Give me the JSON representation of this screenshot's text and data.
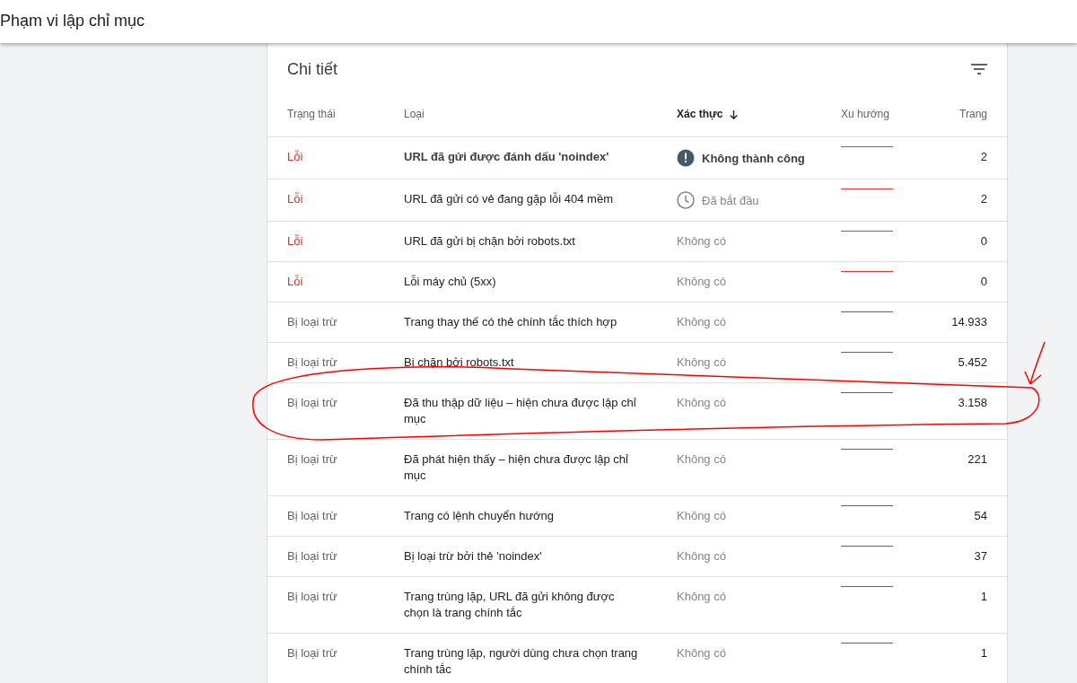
{
  "header": {
    "title": "Phạm vi lập chỉ mục"
  },
  "card": {
    "title": "Chi tiết"
  },
  "table": {
    "columns": [
      {
        "label": "Trạng thái",
        "sorted": false
      },
      {
        "label": "Loại",
        "sorted": false
      },
      {
        "label": "Xác thực",
        "sorted": true
      },
      {
        "label": "Xu hướng",
        "sorted": false
      },
      {
        "label": "Trang",
        "sorted": false
      }
    ],
    "rows": [
      {
        "status": {
          "text": "Lỗi",
          "color": "#d93025"
        },
        "type": "URL đã gửi được đánh dấu 'noindex'",
        "validation": {
          "text": "Không thành công",
          "kind": "failed"
        },
        "trend": {
          "color": "#e53935"
        },
        "pages": "2"
      },
      {
        "status": {
          "text": "Lỗi",
          "color": "#d93025"
        },
        "type": "URL đã gửi có vẻ đang gặp lỗi 404 mềm",
        "validation": {
          "text": "Đã bắt đầu",
          "kind": "started"
        },
        "trend": {
          "color": "#e53935"
        },
        "pages": "2"
      },
      {
        "status": {
          "text": "Lỗi",
          "color": "#d93025"
        },
        "type": "URL đã gửi bị chặn bởi robots.txt",
        "validation": {
          "text": "Không có",
          "kind": "none"
        },
        "trend": {
          "color": "#e53935"
        },
        "pages": "0"
      },
      {
        "status": {
          "text": "Lỗi",
          "color": "#d93025"
        },
        "type": "Lỗi máy chủ (5xx)",
        "validation": {
          "text": "Không có",
          "kind": "none"
        },
        "trend": {
          "color": "#e53935"
        },
        "pages": "0"
      },
      {
        "status": {
          "text": "Bị loại trừ",
          "color": "#5f6368"
        },
        "type": "Trang thay thế có thẻ chính tắc thích hợp",
        "validation": {
          "text": "Không có",
          "kind": "none"
        },
        "trend": {
          "color": "#5f6368"
        },
        "pages": "14.933"
      },
      {
        "status": {
          "text": "Bị loại trừ",
          "color": "#5f6368"
        },
        "type": "Bị chặn bởi robots.txt",
        "validation": {
          "text": "Không có",
          "kind": "none"
        },
        "trend": {
          "color": "#5f6368"
        },
        "pages": "5.452"
      },
      {
        "status": {
          "text": "Bị loại trừ",
          "color": "#5f6368"
        },
        "type": "Đã thu thập dữ liệu – hiện chưa được lập chỉ mục",
        "validation": {
          "text": "Không có",
          "kind": "none"
        },
        "trend": {
          "color": "#5f6368"
        },
        "pages": "3.158"
      },
      {
        "status": {
          "text": "Bị loại trừ",
          "color": "#5f6368"
        },
        "type": "Đã phát hiện thấy – hiện chưa được lập chỉ mục",
        "validation": {
          "text": "Không có",
          "kind": "none"
        },
        "trend": {
          "color": "#5f6368"
        },
        "pages": "221"
      },
      {
        "status": {
          "text": "Bị loại trừ",
          "color": "#5f6368"
        },
        "type": "Trang có lệnh chuyển hướng",
        "validation": {
          "text": "Không có",
          "kind": "none"
        },
        "trend": {
          "color": "#5f6368"
        },
        "pages": "54"
      },
      {
        "status": {
          "text": "Bị loại trừ",
          "color": "#5f6368"
        },
        "type": "Bị loại trừ bởi thẻ 'noindex'",
        "validation": {
          "text": "Không có",
          "kind": "none"
        },
        "trend": {
          "color": "#5f6368"
        },
        "pages": "37"
      },
      {
        "status": {
          "text": "Bị loại trừ",
          "color": "#5f6368"
        },
        "type": "Trang trùng lặp, URL đã gửi không được chọn là trang chính tắc",
        "validation": {
          "text": "Không có",
          "kind": "none"
        },
        "trend": {
          "color": "#5f6368"
        },
        "pages": "1"
      },
      {
        "status": {
          "text": "Bị loại trừ",
          "color": "#5f6368"
        },
        "type": "Trang trùng lặp, người dùng chưa chọn trang chính tắc",
        "validation": {
          "text": "Không có",
          "kind": "none"
        },
        "trend": {
          "color": "#5f6368"
        },
        "pages": "1"
      }
    ]
  }
}
